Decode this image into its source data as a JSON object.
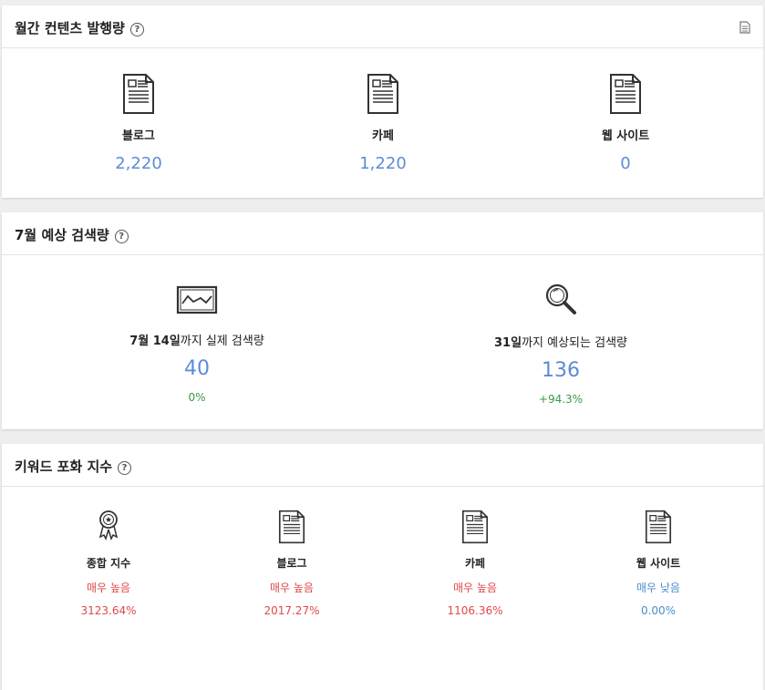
{
  "monthly": {
    "title": "월간 컨텐츠 발행량",
    "help": "?",
    "items": [
      {
        "label": "블로그",
        "value": "2,220"
      },
      {
        "label": "카페",
        "value": "1,220"
      },
      {
        "label": "웹 사이트",
        "value": "0"
      }
    ]
  },
  "forecast": {
    "title": "7월 예상 검색량",
    "help": "?",
    "actual": {
      "bold": "7월 14일",
      "rest": "까지 실제 검색량",
      "value": "40",
      "change": "0%"
    },
    "expected": {
      "bold": "31일",
      "rest": "까지 예상되는 검색량",
      "value": "136",
      "change": "+94.3%"
    }
  },
  "saturation": {
    "title": "키워드 포화 지수",
    "help": "?",
    "items": [
      {
        "label": "종합 지수",
        "level": "매우 높음",
        "value": "3123.64%",
        "tone": "red"
      },
      {
        "label": "블로그",
        "level": "매우 높음",
        "value": "2017.27%",
        "tone": "red"
      },
      {
        "label": "카페",
        "level": "매우 높음",
        "value": "1106.36%",
        "tone": "red"
      },
      {
        "label": "웹 사이트",
        "level": "매우 낮음",
        "value": "0.00%",
        "tone": "blue"
      }
    ]
  },
  "colors": {
    "value_blue": "#5c8bd6",
    "green": "#3a9a4a",
    "red": "#e04848",
    "low_blue": "#4a8fd0"
  }
}
